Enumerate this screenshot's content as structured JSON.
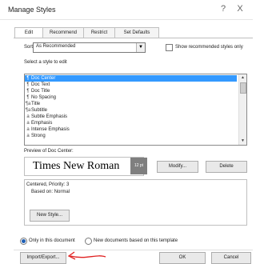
{
  "dialog": {
    "title": "Manage Styles",
    "help_label": "?",
    "close_label": "X"
  },
  "tabs": [
    {
      "label": "Edit",
      "active": true
    },
    {
      "label": "Recommend",
      "active": false
    },
    {
      "label": "Restrict",
      "active": false
    },
    {
      "label": "Set Defaults",
      "active": false
    }
  ],
  "edit": {
    "sort_order_label": "Sort order:",
    "sort_order_value": "As Recommended",
    "show_recommended_label": "Show recommended styles only",
    "select_style_label": "Select a style to edit",
    "styles": [
      {
        "glyph": "¶",
        "name": "Doc Center",
        "selected": true
      },
      {
        "glyph": "¶",
        "name": "Doc Text",
        "selected": false
      },
      {
        "glyph": "¶",
        "name": "Doc Title",
        "selected": false
      },
      {
        "glyph": "¶",
        "name": "No Spacing",
        "selected": false
      },
      {
        "glyph": "¶a",
        "name": "Title",
        "selected": false
      },
      {
        "glyph": "¶a",
        "name": "Subtitle",
        "selected": false
      },
      {
        "glyph": "a",
        "name": "Subtle Emphasis",
        "selected": false
      },
      {
        "glyph": "a",
        "name": "Emphasis",
        "selected": false
      },
      {
        "glyph": "a",
        "name": "Intense Emphasis",
        "selected": false
      },
      {
        "glyph": "a",
        "name": "Strong",
        "selected": false
      }
    ],
    "preview_label": "Preview of Doc Center:",
    "preview_font": "Times New Roman",
    "preview_size": "12 pt",
    "modify_label": "Modify...",
    "delete_label": "Delete",
    "description_line1": "Centered, Priority: 3",
    "description_line2": "Based on: Normal",
    "new_style_label": "New Style..."
  },
  "scope": {
    "only_doc_label": "Only in this document",
    "new_docs_label": "New documents based on this template",
    "selected": "only_doc"
  },
  "footer": {
    "import_export_label": "Import/Export...",
    "ok_label": "OK",
    "cancel_label": "Cancel"
  },
  "colors": {
    "selection": "#3399ff",
    "annotation_arrow": "#e02020"
  }
}
